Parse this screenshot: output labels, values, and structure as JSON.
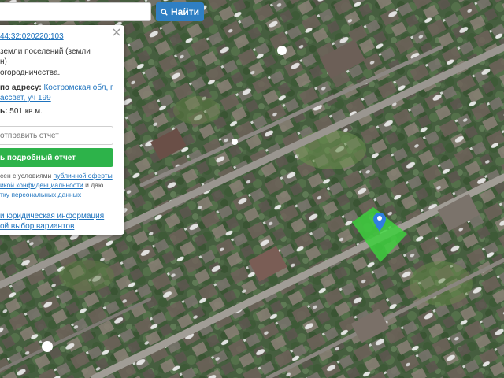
{
  "search": {
    "placeholder": "",
    "button_label": "Найти"
  },
  "panel": {
    "cadastral_number": "44:32:020220:103",
    "category_line1": "земли поселений (земли",
    "category_line2": "н)",
    "usage": "огородничества.",
    "address_label": "по адресу:",
    "address_link_line1": "Костромская обл, г",
    "address_link_line2": "ассвет, уч 199",
    "area_label": "ь:",
    "area_value": "501 кв.м.",
    "send_placeholder": "отправить отчет",
    "report_button": "ь подробный отчет",
    "consent_line1_text": "сен с условиями ",
    "consent_line1_link": "публичной оферты",
    "consent_line2_link": "икой конфиденциальности",
    "consent_line2_text": " и даю",
    "consent_line3_link": "тку персональных данных",
    "legal_line1": "и юридическая информация",
    "legal_line2": "ой выбор вариантов"
  },
  "map": {
    "selected_color": "#3ecf3e",
    "marker_color": "#2f7fe0"
  }
}
